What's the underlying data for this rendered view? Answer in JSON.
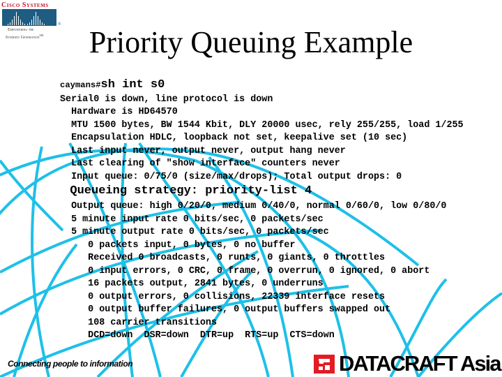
{
  "slide": {
    "title": "Priority Queuing Example",
    "footer_tagline": "Connecting people to information",
    "accent_color": "#1ec0e8"
  },
  "logos": {
    "cisco": {
      "name": "Cisco Systems",
      "tagline_line1": "Empowering the",
      "tagline_line2": "Internet Generation",
      "registered_mark": "®",
      "sm_mark": "SM"
    },
    "datacraft": {
      "name": "DATACRAFT Asia"
    }
  },
  "console": {
    "prompt": "caymans#",
    "command": "sh int s0",
    "lines": [
      "Serial0 is down, line protocol is down",
      "  Hardware is HD64570",
      "  MTU 1500 bytes, BW 1544 Kbit, DLY 20000 usec, rely 255/255, load 1/255",
      "  Encapsulation HDLC, loopback not set, keepalive set (10 sec)",
      "  Last input never, output never, output hang never",
      "  Last clearing of \"show interface\" counters never",
      "  Input queue: 0/75/0 (size/max/drops); Total output drops: 0"
    ],
    "highlight_line": "  Queueing strategy: priority-list 4",
    "lines_after": [
      "  Output queue: high 0/20/0, medium 0/40/0, normal 0/60/0, low 0/80/0",
      "  5 minute input rate 0 bits/sec, 0 packets/sec",
      "  5 minute output rate 0 bits/sec, 0 packets/sec",
      "     0 packets input, 0 bytes, 0 no buffer",
      "     Received 0 broadcasts, 0 runts, 0 giants, 0 throttles",
      "     0 input errors, 0 CRC, 0 frame, 0 overrun, 0 ignored, 0 abort",
      "     16 packets output, 2841 bytes, 0 underruns",
      "     0 output errors, 0 collisions, 22339 interface resets",
      "     0 output buffer failures, 0 output buffers swapped out",
      "     108 carrier transitions",
      "     DCD=down  DSR=down  DTR=up  RTS=up  CTS=down"
    ]
  }
}
